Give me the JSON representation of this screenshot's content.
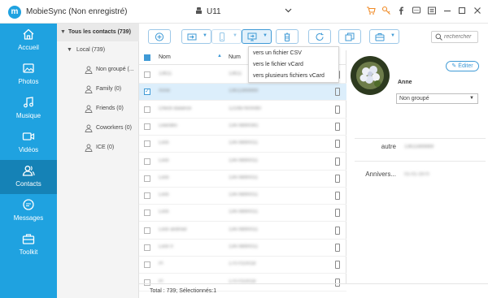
{
  "app": {
    "title": "MobieSync (Non enregistré)",
    "device_name": "U11"
  },
  "sidebar": {
    "items": [
      {
        "label": "Accueil",
        "icon": "home-icon"
      },
      {
        "label": "Photos",
        "icon": "photo-icon"
      },
      {
        "label": "Musique",
        "icon": "music-icon"
      },
      {
        "label": "Vidéos",
        "icon": "video-icon"
      },
      {
        "label": "Contacts",
        "icon": "contacts-icon",
        "active": true
      },
      {
        "label": "Messages",
        "icon": "messages-icon"
      },
      {
        "label": "Toolkit",
        "icon": "toolkit-icon"
      }
    ]
  },
  "groups": {
    "all_label": "Tous les contacts",
    "all_count": "(739)",
    "local_label": "Local",
    "local_count": "(739)",
    "items": [
      {
        "label": "Non groupé",
        "count": "(..."
      },
      {
        "label": "Family",
        "count": "(0)"
      },
      {
        "label": "Friends",
        "count": "(0)"
      },
      {
        "label": "Coworkers",
        "count": "(0)"
      },
      {
        "label": "ICE",
        "count": "(0)"
      }
    ]
  },
  "toolbar": {
    "search_placeholder": "rechercher"
  },
  "table": {
    "header_name": "Nom",
    "header_number": "Num",
    "rows": [
      {
        "name": "13611",
        "number": "13611",
        "selected": false
      },
      {
        "name": "Anne",
        "number": "13611869869",
        "selected": true
      },
      {
        "name": "Check Balance",
        "number": "121987600080",
        "selected": false
      },
      {
        "name": "Leandes",
        "number": "13478890081",
        "selected": false
      },
      {
        "name": "Lock",
        "number": "13478890011",
        "selected": false
      },
      {
        "name": "Lock",
        "number": "13478890011",
        "selected": false
      },
      {
        "name": "Lock",
        "number": "13478890011",
        "selected": false
      },
      {
        "name": "Lock",
        "number": "13478890011",
        "selected": false
      },
      {
        "name": "Lock",
        "number": "13478890011",
        "selected": false
      },
      {
        "name": "Lock android",
        "number": "13478890011",
        "selected": false
      },
      {
        "name": "Lock II",
        "number": "13478890011",
        "selected": false
      },
      {
        "name": "Pl",
        "number": "1707010018",
        "selected": false
      },
      {
        "name": "Pl",
        "number": "1707010018",
        "selected": false
      }
    ],
    "status": "Total : 739; Sélectionnés:1"
  },
  "export_menu": {
    "items": [
      "vers un fichier CSV",
      "vers le fichier vCard",
      "vers plusieurs fichiers vCard"
    ]
  },
  "detail": {
    "edit_label": "Éditer",
    "name": "Anne",
    "group_value": "Non groupé",
    "fields": [
      {
        "label": "autre",
        "value": "13611869869"
      },
      {
        "label": "Annivers...",
        "value": "01-01-1970"
      }
    ]
  },
  "colors": {
    "accent": "#1fa2e0",
    "sidebar_active": "#1582b6",
    "selected_row": "#dceefb",
    "title_icons": "#f08a24"
  }
}
